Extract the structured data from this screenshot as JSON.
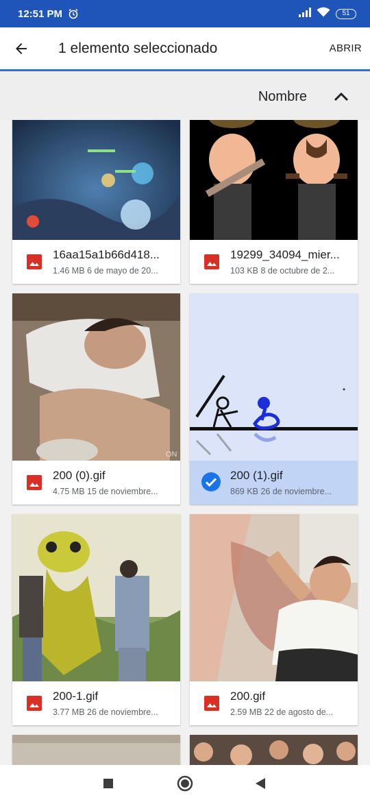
{
  "status_bar": {
    "time": "12:51 PM",
    "battery": "51"
  },
  "app_bar": {
    "title": "1 elemento seleccionado",
    "open_label": "ABRIR"
  },
  "sort": {
    "label": "Nombre",
    "direction": "ascending"
  },
  "files": [
    {
      "name": "16aa15a1b66d418...",
      "meta": "1.46 MB 6 de mayo de 20...",
      "selected": false
    },
    {
      "name": "19299_34094_mier...",
      "meta": "103 KB 8 de octubre de 2...",
      "selected": false
    },
    {
      "name": "200 (0).gif",
      "meta": "4.75 MB 15 de noviembre...",
      "selected": false
    },
    {
      "name": "200 (1).gif",
      "meta": "869 KB 26 de noviembre...",
      "selected": true
    },
    {
      "name": "200-1.gif",
      "meta": "3.77 MB 26 de noviembre...",
      "selected": false
    },
    {
      "name": "200.gif",
      "meta": "2.59 MB 22 de agosto de...",
      "selected": false
    }
  ],
  "icons": {
    "file": "image-file-icon",
    "selected": "check-circle-icon"
  },
  "colors": {
    "status_bar": "#1f55b8",
    "accent": "#2f6fd6",
    "selected_info": "#c2d4f6",
    "file_icon": "#d93025"
  }
}
